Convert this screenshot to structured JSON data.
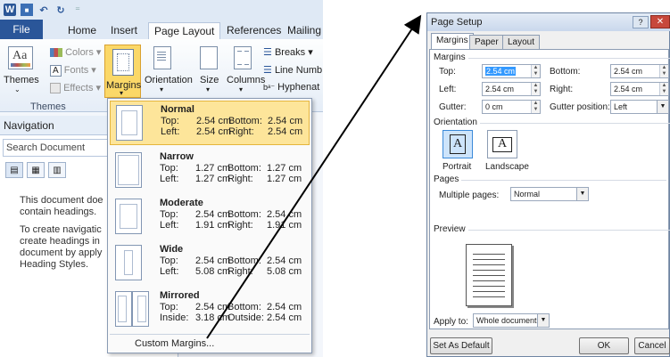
{
  "word": {
    "tabs": {
      "file": "File",
      "home": "Home",
      "insert": "Insert",
      "page_layout": "Page Layout",
      "references": "References",
      "mailings": "Mailing"
    },
    "ribbon": {
      "themes_label": "Themes",
      "colors_label": "Colors",
      "fonts_label": "Fonts",
      "effects_label": "Effects",
      "margins_label": "Margins",
      "orientation_label": "Orientation",
      "size_label": "Size",
      "columns_label": "Columns",
      "breaks_label": "Breaks",
      "line_numbers_label": "Line Numb",
      "hyphenation_label": "Hyphenat",
      "themes_group": "Themes"
    },
    "navigation": {
      "title": "Navigation",
      "search_placeholder": "Search Document",
      "lines": [
        "This document doe",
        "contain headings.",
        "",
        "To create navigatic",
        "create headings in",
        "document by apply",
        "Heading Styles."
      ]
    },
    "margins_menu": {
      "options": [
        {
          "name": "Normal",
          "a_label": "Top:",
          "a_value": "2.54 cm",
          "b_label": "Bottom:",
          "b_value": "2.54 cm",
          "c_label": "Left:",
          "c_value": "2.54 cm",
          "d_label": "Right:",
          "d_value": "2.54 cm"
        },
        {
          "name": "Narrow",
          "a_label": "Top:",
          "a_value": "1.27 cm",
          "b_label": "Bottom:",
          "b_value": "1.27 cm",
          "c_label": "Left:",
          "c_value": "1.27 cm",
          "d_label": "Right:",
          "d_value": "1.27 cm"
        },
        {
          "name": "Moderate",
          "a_label": "Top:",
          "a_value": "2.54 cm",
          "b_label": "Bottom:",
          "b_value": "2.54 cm",
          "c_label": "Left:",
          "c_value": "1.91 cm",
          "d_label": "Right:",
          "d_value": "1.91 cm"
        },
        {
          "name": "Wide",
          "a_label": "Top:",
          "a_value": "2.54 cm",
          "b_label": "Bottom:",
          "b_value": "2.54 cm",
          "c_label": "Left:",
          "c_value": "5.08 cm",
          "d_label": "Right:",
          "d_value": "5.08 cm"
        },
        {
          "name": "Mirrored",
          "a_label": "Top:",
          "a_value": "2.54 cm",
          "b_label": "Bottom:",
          "b_value": "2.54 cm",
          "c_label": "Inside:",
          "c_value": "3.18 cm",
          "d_label": "Outside:",
          "d_value": "2.54 cm"
        }
      ],
      "custom_label": "Custom Margins..."
    }
  },
  "dialog": {
    "title": "Page Setup",
    "help": "?",
    "close": "✕",
    "tabs": {
      "margins": "Margins",
      "paper": "Paper",
      "layout": "Layout"
    },
    "margins_section": "Margins",
    "top_label": "Top:",
    "top_value": "2.54 cm",
    "bottom_label": "Bottom:",
    "bottom_value": "2.54 cm",
    "left_label": "Left:",
    "left_value": "2.54 cm",
    "right_label": "Right:",
    "right_value": "2.54 cm",
    "gutter_label": "Gutter:",
    "gutter_value": "0 cm",
    "gutter_pos_label": "Gutter position:",
    "gutter_pos_value": "Left",
    "orientation_section": "Orientation",
    "portrait_label": "Portrait",
    "landscape_label": "Landscape",
    "pages_section": "Pages",
    "multiple_pages_label": "Multiple pages:",
    "multiple_pages_value": "Normal",
    "preview_section": "Preview",
    "apply_to_label": "Apply to:",
    "apply_to_value": "Whole document",
    "set_default": "Set As Default",
    "ok": "OK",
    "cancel": "Cancel"
  },
  "colors": {
    "accent": "#2a5699",
    "highlight": "#fde59a"
  }
}
